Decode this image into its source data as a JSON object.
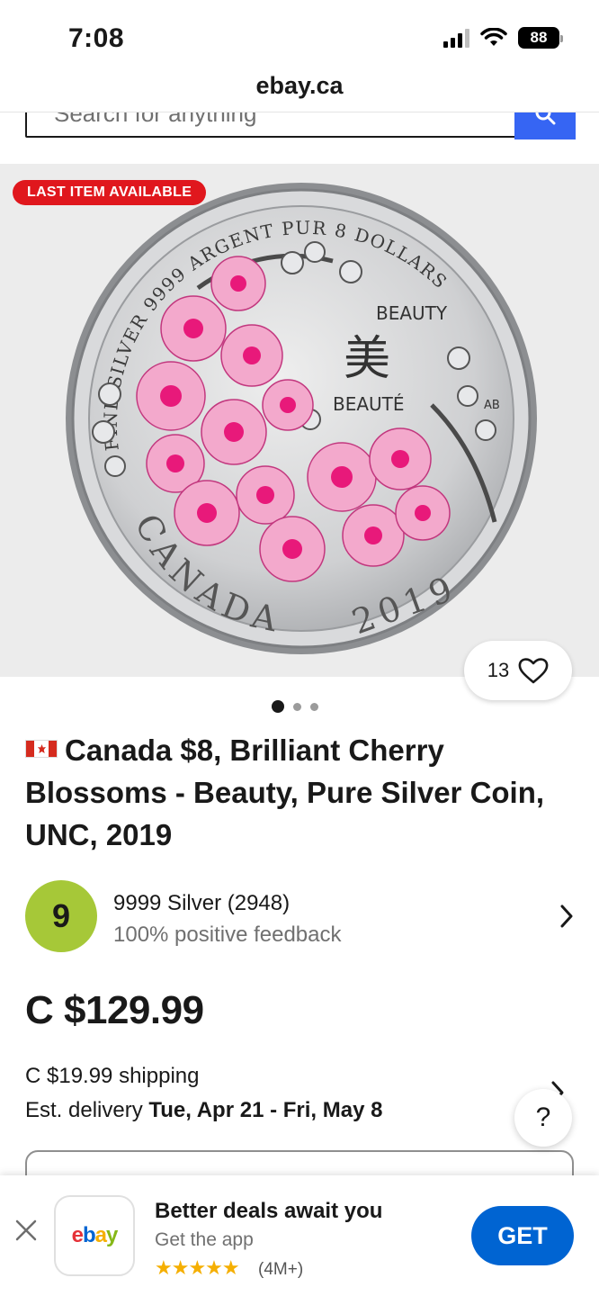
{
  "status": {
    "time": "7:08",
    "battery": "88"
  },
  "browser": {
    "url": "ebay.ca"
  },
  "search": {
    "placeholder": "Search for anything"
  },
  "listing": {
    "badge": "LAST ITEM AVAILABLE",
    "watch_count": "13",
    "title": "Canada $8, Brilliant Cherry Blossoms - Beauty, Pure Silver Coin, UNC, 2019",
    "image_count": 3,
    "active_image": 1,
    "coin_text": {
      "rim_top": "FINE SILVER 9999 ARGENT PUR 8 DOLLARS",
      "beauty_en": "BEAUTY",
      "character": "美",
      "beauty_fr": "BEAUTÉ",
      "initials": "AB",
      "country": "CANADA",
      "year": "2019"
    }
  },
  "seller": {
    "avatar_letter": "9",
    "name": "9999 Silver (2948)",
    "feedback": "100% positive feedback"
  },
  "price": "C $129.99",
  "shipping": {
    "cost": "C $19.99 shipping",
    "delivery_label": "Est. delivery",
    "delivery_dates": "Tue, Apr 21 - Fri, May 8"
  },
  "help": {
    "label": "?"
  },
  "app_banner": {
    "logo": [
      "e",
      "b",
      "a",
      "y"
    ],
    "headline": "Better deals await you",
    "sub": "Get the app",
    "stars": "★★★★★",
    "rating_count": "(4M+)",
    "get_label": "GET"
  },
  "colors": {
    "accent_blue": "#3665f3",
    "badge_red": "#e0171d",
    "get_blue": "#0064d2",
    "seller_avatar": "#a6c838"
  }
}
